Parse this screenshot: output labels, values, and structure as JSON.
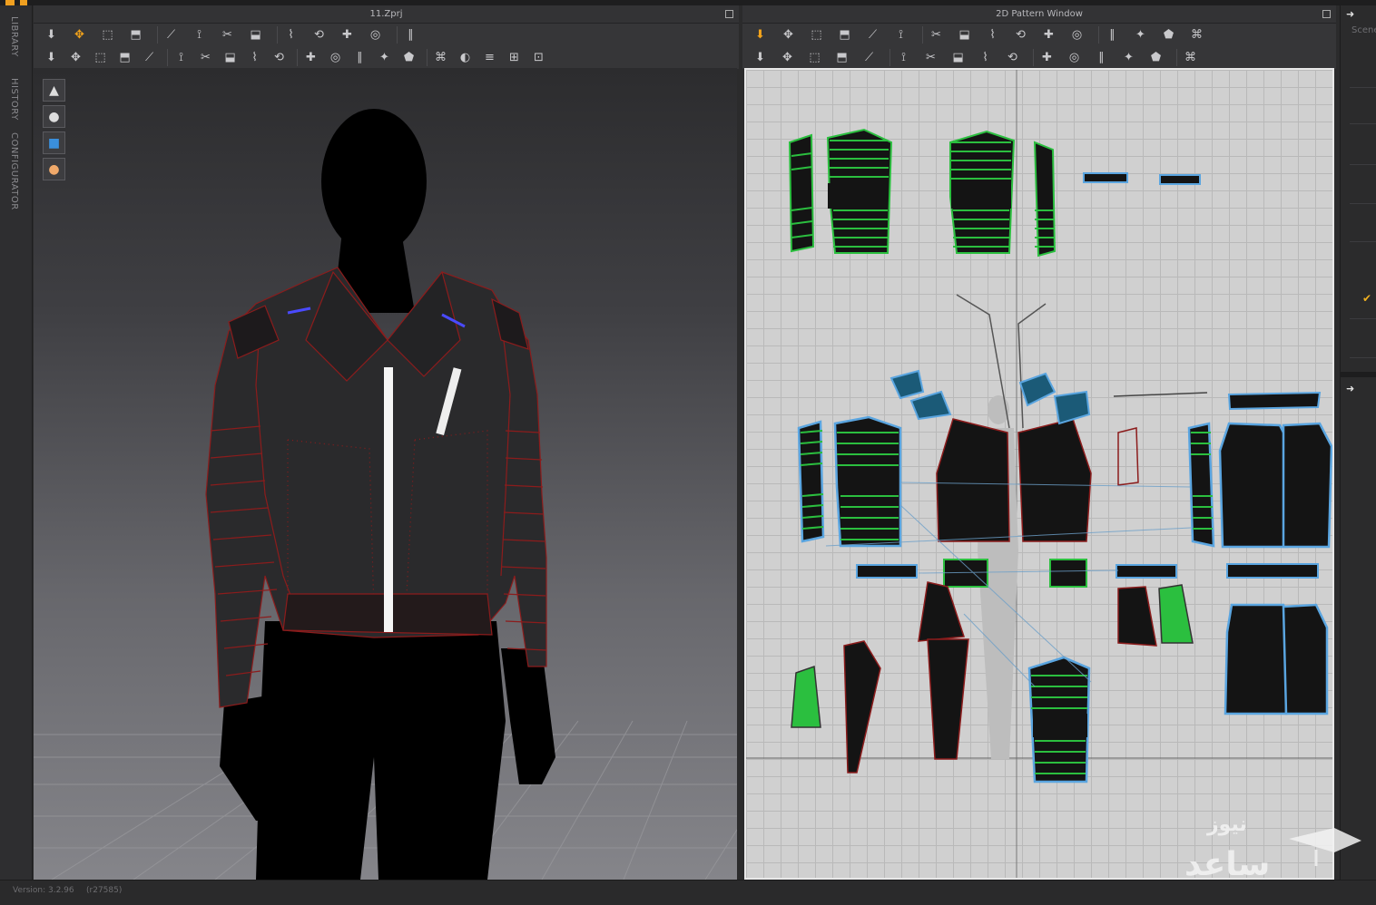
{
  "left_tabs": [
    "LIBRARY",
    "HISTORY",
    "CONFIGURATOR"
  ],
  "viewport3d": {
    "title": "11.Zprj",
    "toolbar_row1_icons": [
      "select-move-icon",
      "transform-pattern-icon",
      "box-select-icon",
      "edit-pin-icon",
      "fold-arrange-icon",
      "edit-sewing-icon",
      "segment-sewing-icon",
      "free-sewing-icon",
      "shirt-tack-icon",
      "shirt-icon",
      "needle-icon",
      "lasso-icon",
      "ruler-icon"
    ],
    "toolbar_row2_icons": [
      "walk-avatar-icon",
      "pin-icon",
      "pins-icon",
      "tape-icon",
      "hanger-icon",
      "fold-icon",
      "graphic-icon",
      "button-icon",
      "buttonhole-icon",
      "zipper-icon",
      "line-icon",
      "puckering-icon",
      "lock-icon",
      "measure-icon",
      "flat-icon",
      "level-icon",
      "align-icon",
      "shirt-fit-icon",
      "shirt-up-icon",
      "gloves-icon"
    ],
    "side_tools": [
      "garment-view-icon",
      "avatar-view-icon",
      "fabric-view-icon",
      "skin-view-icon"
    ]
  },
  "pattern_window": {
    "title": "2D Pattern Window",
    "toolbar_row1_icons": [
      "edit-pattern-icon",
      "edit-point-icon",
      "edit-curve-icon",
      "curve-point-icon",
      "add-point-icon",
      "corner-icon",
      "polygon-icon",
      "rectangle-icon",
      "circle-icon",
      "internal-polygon-icon",
      "internal-rectangle-icon",
      "internal-circle-icon",
      "dart-icon",
      "trace-icon",
      "pleat-icon",
      "tuck-icon"
    ],
    "toolbar_row2_icons": [
      "transform-icon",
      "seam-allowance-icon",
      "edit-grade-icon",
      "tack-icon",
      "iron-icon",
      "shirt-icon",
      "hanger-icon",
      "button-icon",
      "buttonhole-icon",
      "topstitch-icon",
      "segment-icon",
      "stitch-icon",
      "wave-stitch-icon",
      "pin-icon",
      "texture-icon",
      "fabric-grid-icon"
    ]
  },
  "right_panel": {
    "scene_label": "Scene"
  },
  "status": {
    "version": "Version: 3.2.96",
    "revision": "(r27585)"
  },
  "watermark": {
    "text_top": "نیوز",
    "text_bottom": "ساعد"
  }
}
